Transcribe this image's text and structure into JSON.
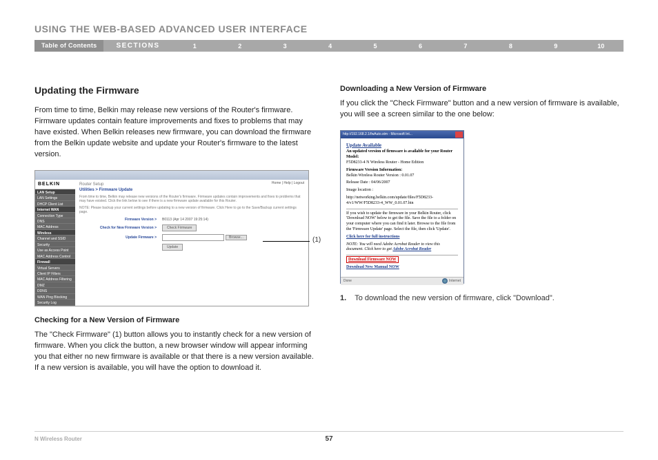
{
  "chapter_title": "USING THE WEB-BASED ADVANCED USER INTERFACE",
  "nav": {
    "toc": "Table of Contents",
    "sections": "SECTIONS",
    "numbers": [
      "1",
      "2",
      "3",
      "4",
      "5",
      "6",
      "7",
      "8",
      "9",
      "10"
    ],
    "active": "6"
  },
  "left": {
    "heading": "Updating the Firmware",
    "para1": "From time to time, Belkin may release new versions of the Router's firmware. Firmware updates contain feature improvements and fixes to problems that may have existed. When Belkin releases new firmware, you can download the firmware from the Belkin update website and update your Router's firmware to the latest version.",
    "screenshot1": {
      "logo": "BELKIN",
      "router_setup": "Router Setup",
      "top_links": "Home | Help | Logout",
      "sidebar": [
        "LAN Setup",
        "LAN Settings",
        "DHCP Client List",
        "Internet WAN",
        "Connection Type",
        "DNS",
        "MAC Address",
        "Wireless",
        "Channel and SSID",
        "Security",
        "Use as Access Point",
        "MAC Address Control",
        "Firewall",
        "Virtual Servers",
        "Client IP Filters",
        "MAC Address Filtering",
        "DMZ",
        "DDNS",
        "WAN Ping Blocking",
        "Security Log"
      ],
      "sidebar_hl": [
        "LAN Setup",
        "Internet WAN",
        "Wireless",
        "Firewall"
      ],
      "breadcrumb": "Utilities > Firmware Update",
      "para_a": "From time to time, Belkin may release new versions of the Router's firmware. Firmware updates contain improvements and fixes to problems that may have existed. Click the link below to see if there is a new firmware update available for this Router.",
      "para_b": "NOTE: Please backup your current settings before updating to a new version of firmware. Click Here to go to the Save/Backup current settings page.",
      "row1_label": "Firmware Version >",
      "row1_val": "B0113 (Apr 14 2007 19:25:14)",
      "row2_label": "Check for New Firmware Version >",
      "row2_btn": "Check Firmware",
      "row3_label": "Update Firmware >",
      "row3_btn": "Browse...",
      "row4_btn": "Update",
      "callout": "(1)"
    },
    "sub1_heading": "Checking for a New Version of Firmware",
    "sub1_para": "The \"Check Firmware\" (1) button allows you to instantly check for a new version of firmware. When you click the button, a new browser window will appear informing you that either no new firmware is available or that there is a new version available. If a new version is available, you will have the option to download it."
  },
  "right": {
    "heading": "Downloading a New Version of Firmware",
    "para1": "If you click the \"Check Firmware\" button and a new version of firmware is available, you will see a screen similar to the one below:",
    "screenshot2": {
      "titlebar": "http://192.168.2.1/fwAuto.stm - Microsoft Int...",
      "h1": "Update Available",
      "line1": "An updated version of firmware is available for your Router",
      "model_label": "Model:",
      "model": "F5D8233-4 N Wireless Router - Home Edition",
      "fvi_label": "Firmware Version Information:",
      "fvi1": "Belkin Wireless Router Version : 0.01.07",
      "fvi2": "Release Date : 04/06/2007",
      "fvi3": "Image location :",
      "fvi4": "http://networking.belkin.com/update/files/F5D8233-4/v1/WW/F5D8233-4_WW_0.01.07.bin",
      "instr": "If you wish to update the firmware in your Belkin Router, click 'Download NOW' below to get the file. Save the file to a folder on your computer where you can find it later. Browse to the file from the 'Firmware Update' page. Select the file, then click 'Update'.",
      "click_full": "Click here for full instructions",
      "note": "NOTE: You will need Adobe Acrobat Reader to view this document. Click here to get ",
      "adobe": "Adobe Acrobat Reader",
      "dl_fw": "Download Firmware NOW",
      "dl_man": "Download New Manual NOW",
      "status_done": "Done",
      "status_internet": "Internet"
    },
    "step1_num": "1.",
    "step1_text": "To download the new version of firmware, click \"Download\"."
  },
  "footer": {
    "product": "N Wireless Router",
    "page": "57"
  }
}
